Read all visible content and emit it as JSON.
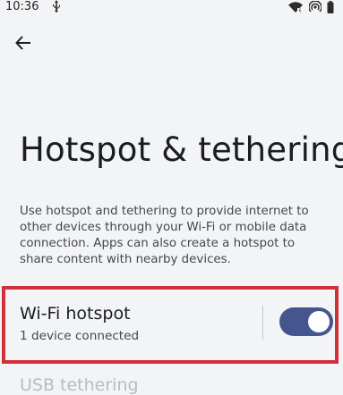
{
  "status_bar": {
    "time": "10:36",
    "icons": [
      "usb-icon",
      "wifi-hotspot-icon",
      "hotspot-icon",
      "battery-icon"
    ]
  },
  "navigation": {
    "back_icon": "arrow-back-icon"
  },
  "page": {
    "title": "Hotspot & tethering",
    "description": "Use hotspot and tethering to provide internet to other devices through your Wi-Fi or mobile data connection. Apps can also create a hotspot to share content with nearby devices."
  },
  "settings": {
    "wifi_hotspot": {
      "title": "Wi-Fi hotspot",
      "subtitle": "1 device connected",
      "enabled": true
    },
    "usb_tethering": {
      "title": "USB tethering"
    }
  },
  "colors": {
    "background": "#f3f4f6",
    "highlight_border": "#d32f3a",
    "toggle_on": "#45568f",
    "text_primary": "#1b1c1f",
    "text_secondary": "#45474d"
  }
}
